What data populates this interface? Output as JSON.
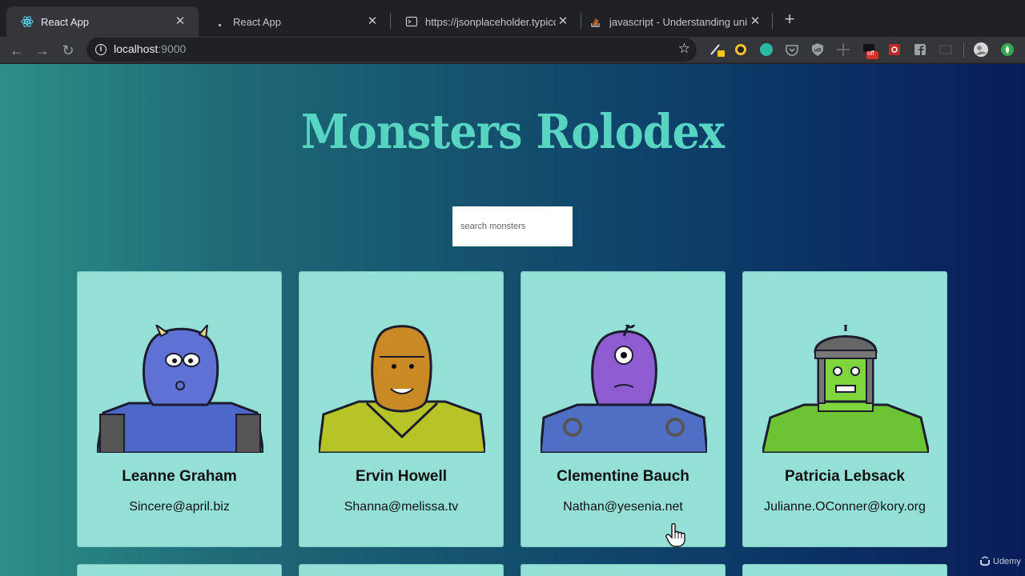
{
  "browser": {
    "tabs": [
      {
        "title": "React App",
        "active": true
      },
      {
        "title": "React App",
        "active": false
      },
      {
        "title": "https://jsonplaceholder.typicode",
        "active": false
      },
      {
        "title": "javascript - Understanding uni",
        "active": false
      }
    ],
    "url_host": "localhost",
    "url_port": ":9000",
    "extension_badge": "off"
  },
  "page": {
    "title": "Monsters Rolodex",
    "search_placeholder": "search monsters",
    "monsters": [
      {
        "name": "Leanne Graham",
        "email": "Sincere@april.biz",
        "body_color": "#5e72d6",
        "shirt_color": "#4e68c9"
      },
      {
        "name": "Ervin Howell",
        "email": "Shanna@melissa.tv",
        "body_color": "#c98a25",
        "shirt_color": "#b6c428"
      },
      {
        "name": "Clementine Bauch",
        "email": "Nathan@yesenia.net",
        "body_color": "#8f5bd1",
        "shirt_color": "#4f6fc4"
      },
      {
        "name": "Patricia Lebsack",
        "email": "Julianne.OConner@kory.org",
        "body_color": "#7ed63c",
        "shirt_color": "#6cc432"
      }
    ],
    "card_bg": "#95e0d6",
    "title_color": "#58d4c2"
  },
  "watermark": "Udemy"
}
